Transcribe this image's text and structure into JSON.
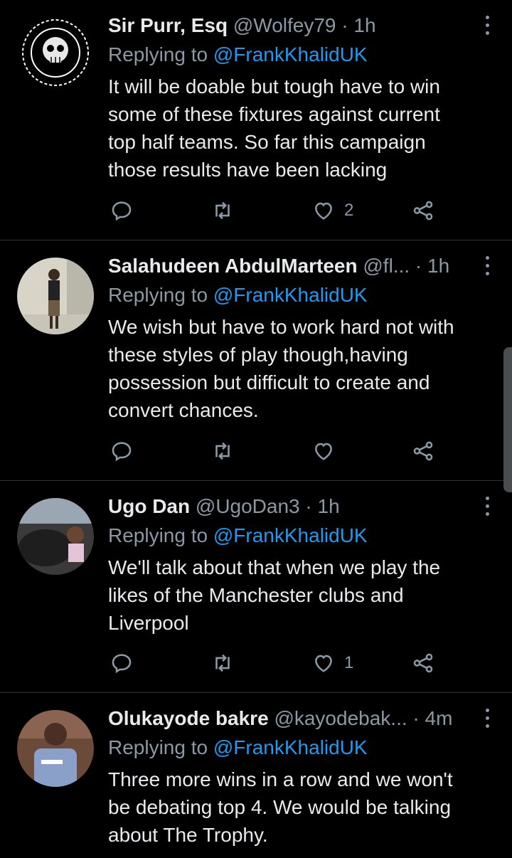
{
  "tweets": [
    {
      "name": "Sir Purr, Esq",
      "handle": "@Wolfey79",
      "time": "1h",
      "replying_prefix": "Replying to",
      "replying_to": "@FrankKhalidUK",
      "text": "It will be doable but tough have to win some of these fixtures against current top half teams. So far this campaign those results have been lacking",
      "likes": "2",
      "avatar_colors": [
        "#000000",
        "#ffffff"
      ]
    },
    {
      "name": "Salahudeen AbdulMarteen",
      "handle": "@fl...",
      "time": "1h",
      "replying_prefix": "Replying to",
      "replying_to": "@FrankKhalidUK",
      "text": "We wish but have to work hard not with these styles of play though,having possession but difficult to create and convert chances.",
      "likes": "",
      "avatar_colors": [
        "#d8d4c8",
        "#2a2a2a"
      ]
    },
    {
      "name": "Ugo Dan",
      "handle": "@UgoDan3",
      "time": "1h",
      "replying_prefix": "Replying to",
      "replying_to": "@FrankKhalidUK",
      "text": "We'll talk about that when we play the likes of the Manchester clubs and Liverpool",
      "likes": "1",
      "avatar_colors": [
        "#3a3a3a",
        "#e6c4b0"
      ]
    },
    {
      "name": "Olukayode bakre",
      "handle": "@kayodebak...",
      "time": "4m",
      "replying_prefix": "Replying to",
      "replying_to": "@FrankKhalidUK",
      "text": "Three more wins in a row and we won't be debating top 4. We would be talking about The Trophy.",
      "likes": "",
      "avatar_colors": [
        "#6b4a3a",
        "#8aa0c8"
      ]
    }
  ],
  "icons": {
    "reply": "reply-icon",
    "retweet": "retweet-icon",
    "like": "heart-icon",
    "share": "share-icon",
    "more": "more-vertical-icon"
  },
  "colors": {
    "background": "#000000",
    "link": "#1d9bf0",
    "secondary": "#8b98a5",
    "divider": "#2f3336"
  }
}
